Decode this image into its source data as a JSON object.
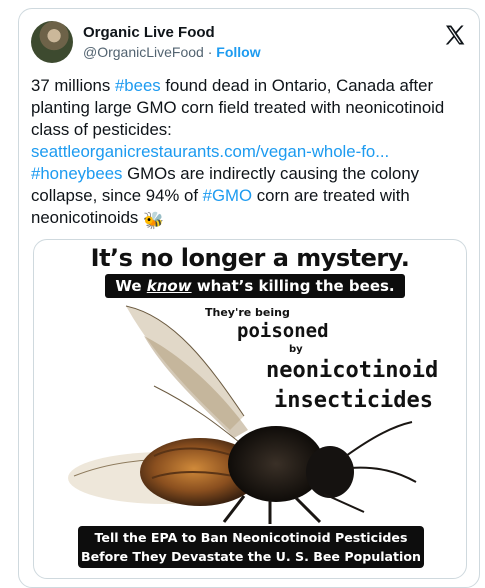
{
  "author": {
    "display_name": "Organic Live Food",
    "handle": "@OrganicLiveFood",
    "separator": "·",
    "follow_label": "Follow"
  },
  "tweet": {
    "part1": "37 millions ",
    "tag_bees": "#bees",
    "part2": " found dead in Ontario, Canada after planting large GMO corn field treated with neonicotinoid class of pesticides:",
    "link": "seattleorganicrestaurants.com/vegan-whole-fo...",
    "tag_honeybees": "#honeybees",
    "part3": " GMOs are indirectly causing the colony collapse, since 94% of ",
    "tag_gmo": "#GMO",
    "part4": " corn are treated with neonicotinoids ",
    "emoji": "🐝"
  },
  "poster": {
    "title": "It’s no longer a mystery.",
    "bar_pre": "We ",
    "bar_em": "know",
    "bar_post": " what’s killing the bees.",
    "being": "They're being",
    "poisoned": "poisoned",
    "by": "by",
    "neonicotinoid": "neonicotinoid",
    "insecticides": "insecticides",
    "banner_line1": "Tell the EPA to Ban Neonicotinoid Pesticides",
    "banner_line2": "Before They Devastate the U. S. Bee Population"
  },
  "icons": {
    "x_logo": "x-logo-icon",
    "avatar": "avatar"
  },
  "colors": {
    "link": "#1d9bf0",
    "text": "#0f1419",
    "muted": "#536471",
    "border": "#cfd9de"
  }
}
